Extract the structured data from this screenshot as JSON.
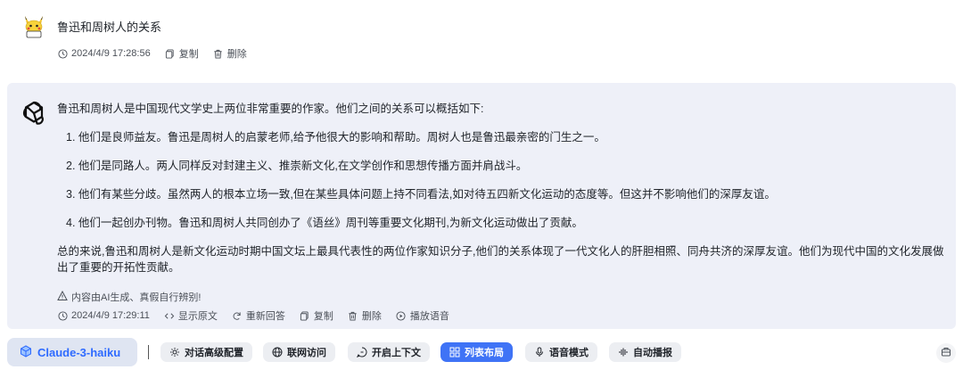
{
  "user_message": {
    "text": "鲁迅和周树人的关系",
    "timestamp": "2024/4/9 17:28:56",
    "copy_label": "复制",
    "delete_label": "删除"
  },
  "assistant_message": {
    "intro": "鲁迅和周树人是中国现代文学史上两位非常重要的作家。他们之间的关系可以概括如下:",
    "points": [
      "1. 他们是良师益友。鲁迅是周树人的启蒙老师,给予他很大的影响和帮助。周树人也是鲁迅最亲密的门生之一。",
      "2. 他们是同路人。两人同样反对封建主义、推崇新文化,在文学创作和思想传播方面并肩战斗。",
      "3. 他们有某些分歧。虽然两人的根本立场一致,但在某些具体问题上持不同看法,如对待五四新文化运动的态度等。但这并不影响他们的深厚友谊。",
      "4. 他们一起创办刊物。鲁迅和周树人共同创办了《语丝》周刊等重要文化期刊,为新文化运动做出了贡献。"
    ],
    "summary": "总的来说,鲁迅和周树人是新文化运动时期中国文坛上最具代表性的两位作家知识分子,他们的关系体现了一代文化人的肝胆相照、同舟共济的深厚友谊。他们为现代中国的文化发展做出了重要的开拓性贡献。",
    "ai_warning": "内容由AI生成、真假自行辨别!",
    "timestamp": "2024/4/9 17:29:11",
    "actions": {
      "show_source": "显示原文",
      "regenerate": "重新回答",
      "copy": "复制",
      "delete": "删除",
      "play_audio": "播放语音"
    }
  },
  "toolbar": {
    "model": "Claude-3-haiku",
    "separator": "|",
    "buttons": [
      {
        "label": "对话高级配置",
        "icon": "gear-icon",
        "active": false
      },
      {
        "label": "联网访问",
        "icon": "globe-icon",
        "active": false
      },
      {
        "label": "开启上下文",
        "icon": "context-icon",
        "active": false
      },
      {
        "label": "列表布局",
        "icon": "grid-icon",
        "active": true
      },
      {
        "label": "语音模式",
        "icon": "microphone-icon",
        "active": false
      },
      {
        "label": "自动播报",
        "icon": "soundwave-icon",
        "active": false
      }
    ]
  },
  "colors": {
    "accent": "#3f73f6",
    "model_text": "#2f6bff",
    "panel_bg": "#eef0f8",
    "pill_bg": "#eceef2"
  }
}
